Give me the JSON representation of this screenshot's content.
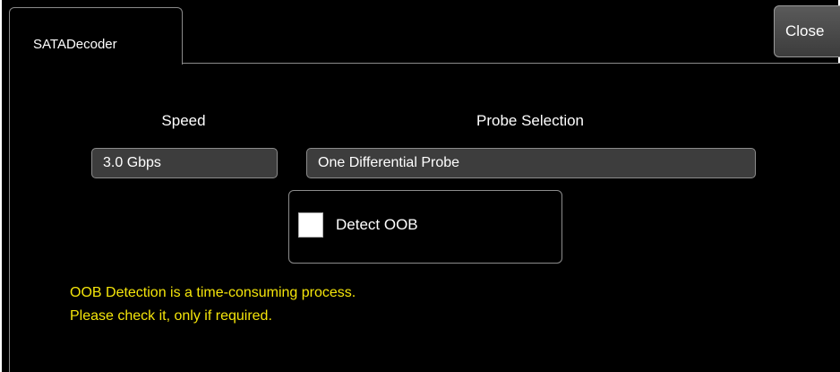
{
  "tab": {
    "label": "SATADecoder"
  },
  "close_button": {
    "label": "Close"
  },
  "speed": {
    "caption": "Speed",
    "value": "3.0 Gbps"
  },
  "probe": {
    "caption": "Probe Selection",
    "value": "One Differential Probe"
  },
  "detect_oob": {
    "label": "Detect OOB",
    "checked": false
  },
  "warning": {
    "line1": "OOB Detection is a time-consuming process.",
    "line2": "Please check it, only if required."
  },
  "colors": {
    "background": "#000000",
    "field_bg": "#3d3d3d",
    "border": "#8c8c8c",
    "warning_text": "#f5e50a"
  }
}
